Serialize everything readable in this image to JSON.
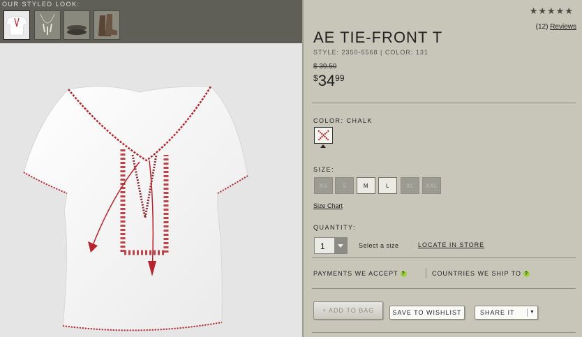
{
  "styled_look": {
    "label": "OUR STYLED LOOK:",
    "thumbnails": [
      "tie-front tee",
      "necklace",
      "bracelets",
      "boots"
    ]
  },
  "product": {
    "rating_stars": "★★★★★",
    "rating_value": 4.5,
    "review_count": "(12)",
    "reviews_label": "Reviews",
    "title": "AE TIE-FRONT T",
    "style_line": "STYLE: 2350-5568 | COLOR: 131",
    "old_price": "$ 39.50",
    "price_symbol": "$",
    "price_dollars": "34",
    "price_cents": "99"
  },
  "color": {
    "label": "COLOR: CHALK"
  },
  "size": {
    "label": "SIZE:",
    "options": [
      {
        "label": "XS",
        "available": false
      },
      {
        "label": "S",
        "available": false
      },
      {
        "label": "M",
        "available": true
      },
      {
        "label": "L",
        "available": true
      },
      {
        "label": "XL",
        "available": false
      },
      {
        "label": "XXL",
        "available": false
      }
    ],
    "chart_link": "Size Chart"
  },
  "quantity": {
    "label": "QUANTITY:",
    "value": "1",
    "hint": "Select a size",
    "locate_link": "LOCATE IN STORE"
  },
  "info": {
    "payments": "PAYMENTS WE ACCEPT",
    "countries": "COUNTRIES WE SHIP TO",
    "help_glyph": "?"
  },
  "actions": {
    "add_to_bag": "+ ADD TO BAG",
    "save_wishlist": "SAVE TO WISHLIST",
    "share": "SHARE IT",
    "share_dropdown": "▼"
  },
  "colors": {
    "panel_bg": "#c7c6b8",
    "styled_bar": "#5f5f58",
    "embroidery_red": "#b3242b",
    "help_green": "#9cd33a"
  }
}
